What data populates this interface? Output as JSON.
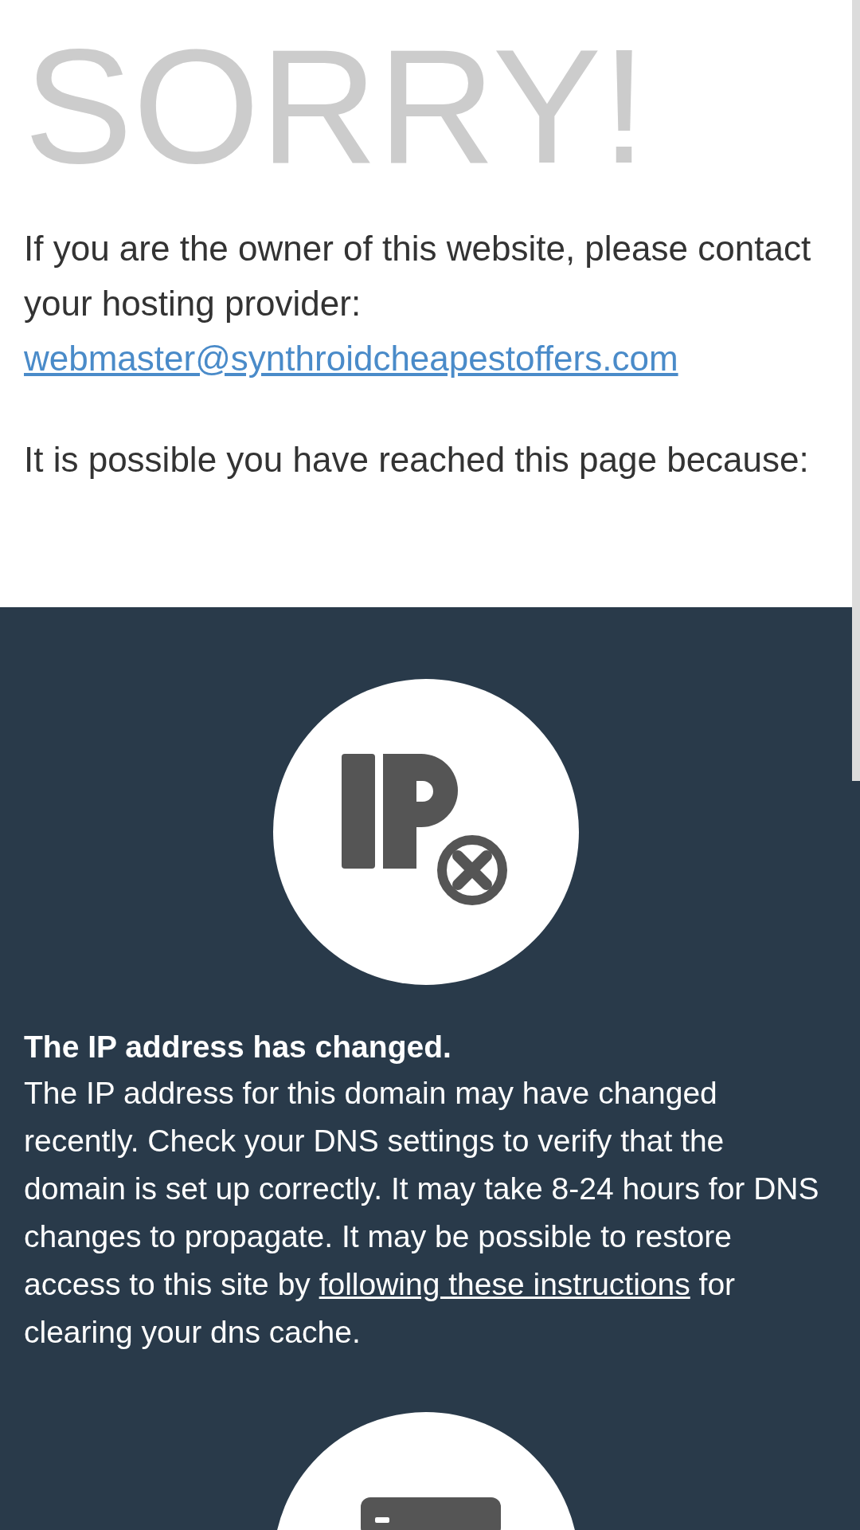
{
  "heading": "SORRY!",
  "intro": {
    "text": "If you are the owner of this website, please contact your hosting provider:",
    "email": "webmaster@synthroidcheapestoffers.com"
  },
  "reason_intro": "It is possible you have reached this page because:",
  "reasons": [
    {
      "kind": "ip",
      "title": "The IP address has changed.",
      "text_before": "The IP address for this domain may have changed recently. Check your DNS settings to verify that the domain is set up correctly. It may take 8-24 hours for DNS changes to propagate. It may be possible to restore access to this site by",
      "link": "following these instructions",
      "text_after": "for clearing your dns cache."
    },
    {
      "kind": "server"
    }
  ]
}
